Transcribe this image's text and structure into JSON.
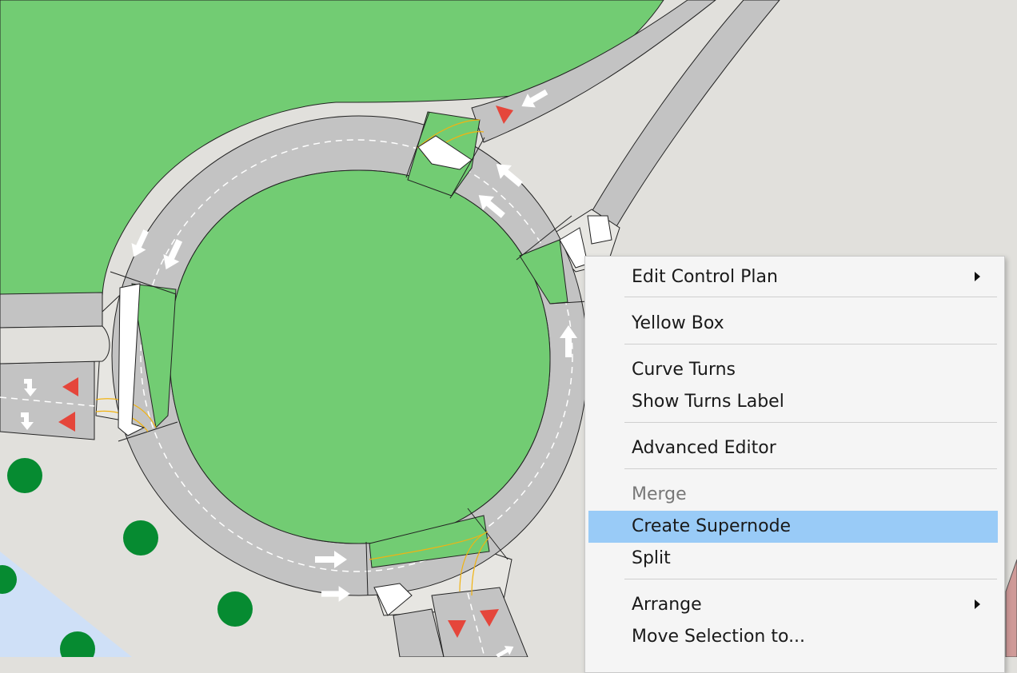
{
  "colors": {
    "background": "#e1e0dc",
    "grass": "#72cc73",
    "road": "#c3c3c3",
    "water": "#cfe0f7",
    "tree": "#068b31",
    "signal": "#e5463b",
    "menu_bg": "#f5f5f5",
    "menu_highlight": "#99cbf7"
  },
  "context_menu": {
    "items": [
      {
        "label": "Edit Control Plan",
        "submenu": true
      },
      {
        "label": "Yellow Box"
      },
      {
        "label": "Curve Turns"
      },
      {
        "label": "Show Turns Label"
      },
      {
        "label": "Advanced Editor"
      },
      {
        "label": "Merge",
        "disabled": true
      },
      {
        "label": "Create Supernode",
        "highlighted": true
      },
      {
        "label": "Split"
      },
      {
        "label": "Arrange",
        "submenu": true
      },
      {
        "label": "Move Selection to..."
      }
    ]
  }
}
